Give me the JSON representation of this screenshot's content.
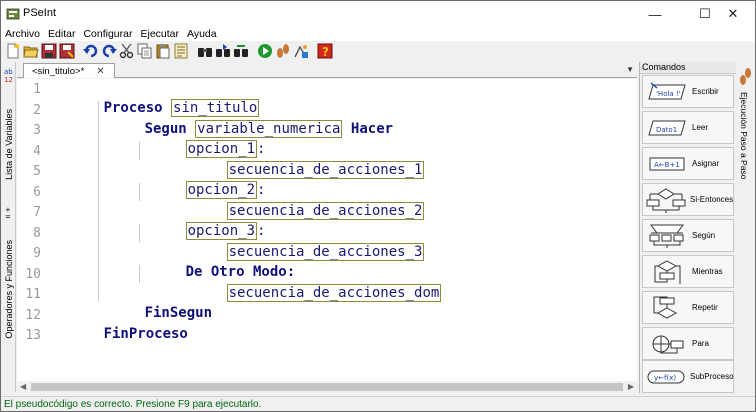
{
  "window": {
    "title": "PSeInt",
    "minimize_glyph": "—",
    "maximize_glyph": "☐",
    "close_glyph": "✕"
  },
  "menu": [
    "Archivo",
    "Editar",
    "Configurar",
    "Ejecutar",
    "Ayuda"
  ],
  "toolbar": {
    "icons": [
      "new-file-icon",
      "open-folder-icon",
      "save-icon",
      "save-as-icon",
      "undo-icon",
      "redo-icon",
      "cut-icon",
      "copy-icon",
      "paste-icon",
      "notes-icon",
      "find-icon",
      "find-next-icon",
      "replace-icon",
      "run-icon",
      "step-icon",
      "debug-icon",
      "help-icon"
    ]
  },
  "left_tabs": {
    "variables": "Lista de Variables",
    "operators": "Operadores y Funciones"
  },
  "editor": {
    "tab_label": "<sin_titulo>*",
    "tab_close": "✕",
    "tabs_menu_glyph": "▼",
    "line_numbers": [
      "1",
      "2",
      "3",
      "4",
      "5",
      "6",
      "7",
      "8",
      "9",
      "10",
      "11",
      "12",
      "13"
    ],
    "code": {
      "l1_kw": "Proceso",
      "l1_ph": "sin_titulo",
      "l2_kw1": "Segun",
      "l2_ph": "variable_numerica",
      "l2_kw2": "Hacer",
      "l3_ph": "opcion_1",
      "l3_colon": ":",
      "l4_ph": "secuencia_de_acciones_1",
      "l5_ph": "opcion_2",
      "l5_colon": ":",
      "l6_ph": "secuencia_de_acciones_2",
      "l7_ph": "opcion_3",
      "l7_colon": ":",
      "l8_ph": "secuencia_de_acciones_3",
      "l9_kw": "De Otro Modo",
      "l9_colon": ":",
      "l10_ph": "secuencia_de_acciones_dom",
      "l11_kw": "FinSegun",
      "l12_kw": "FinProceso"
    }
  },
  "commands": {
    "header": "Comandos",
    "items": [
      {
        "label": "Escribir",
        "icon_text": "'Hola !'"
      },
      {
        "label": "Leer",
        "icon_text": "Dato1"
      },
      {
        "label": "Asignar",
        "icon_text": "A←B+1"
      },
      {
        "label": "Si-Entonces",
        "icon_text": ""
      },
      {
        "label": "Según",
        "icon_text": ""
      },
      {
        "label": "Mientras",
        "icon_text": ""
      },
      {
        "label": "Repetir",
        "icon_text": ""
      },
      {
        "label": "Para",
        "icon_text": ""
      },
      {
        "label": "SubProceso",
        "icon_text": "y←f(x)"
      }
    ]
  },
  "right_tab": {
    "label": "Ejecución Paso a Paso"
  },
  "status": {
    "text": "El pseudocódigo es correcto. Presione F9 para ejecutarlo."
  },
  "colors": {
    "keyword": "#10107a",
    "placeholder_border": "#8c8c3c",
    "status_ok": "#00660f"
  }
}
